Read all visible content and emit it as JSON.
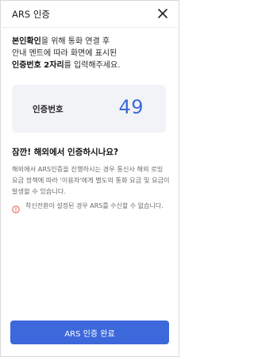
{
  "header": {
    "title": "ARS 인증",
    "close_icon": "close-icon"
  },
  "intro": {
    "line1_bold": "본인확인",
    "line1_rest": "을 위해 통화 연결 후",
    "line2": "안내 멘트에 따라 화면에 표시된",
    "line3_bold": "인증번호 2자리",
    "line3_rest": "를 입력해주세요."
  },
  "code": {
    "label": "인증번호",
    "value": "49"
  },
  "abroad": {
    "title": "잠깐! 해외에서 인증하시나요?",
    "description": "해외에서 ARS인증을 진행하시는 경우 통신사 해외 로밍 요금 정책에 따라 '이용자'에게 별도의 통화 요금 및 요금이 발생할 수 있습니다."
  },
  "notice": {
    "icon": "alert-circle-icon",
    "text": "착신전환이 설정된 경우 ARS를 수신할 수 없습니다."
  },
  "footer": {
    "confirm_label": "ARS 인증 완료"
  },
  "colors": {
    "accent": "#3d68db",
    "code_value": "#3b6ad9",
    "alert": "#e05a4f",
    "card_bg": "#f2f3f6"
  }
}
